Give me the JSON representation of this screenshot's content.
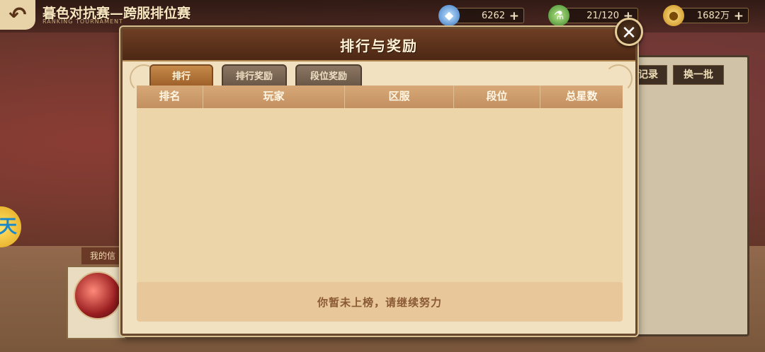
{
  "header": {
    "back_icon": "back-arrow-icon",
    "title": "暮色对抗赛—跨服排位赛",
    "subtitle": "RANKING TOURNAMENT"
  },
  "resources": [
    {
      "icon": "diamond-icon",
      "value": "6262",
      "plus": "+"
    },
    {
      "icon": "potion-icon",
      "value": "21/120",
      "plus": "+"
    },
    {
      "icon": "gold-coin-icon",
      "value": "1682万",
      "plus": "+"
    }
  ],
  "right_panel": {
    "record_button": "记录",
    "refresh_button": "换一批"
  },
  "left_panel": {
    "my_info_tab": "我的信",
    "side_badge": "天"
  },
  "dialog": {
    "title": "排行与奖励",
    "close_icon": "close-icon",
    "tabs": [
      {
        "label": "排行",
        "active": true
      },
      {
        "label": "排行奖励",
        "active": false
      },
      {
        "label": "段位奖励",
        "active": false
      }
    ],
    "columns": [
      "排名",
      "玩家",
      "区服",
      "段位",
      "总星数"
    ],
    "rows": [],
    "footer_message": "你暂未上榜，请继续努力"
  }
}
